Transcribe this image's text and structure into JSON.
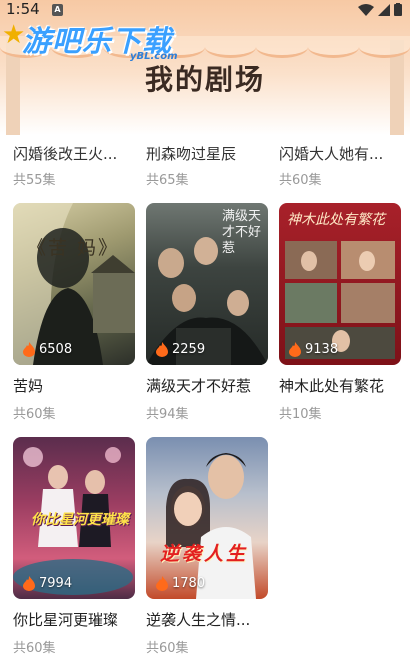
{
  "status": {
    "time": "1:54",
    "notif": "A"
  },
  "watermark": {
    "main": "游吧乐下载",
    "sub": "yBL.com"
  },
  "page_title": "我的剧场",
  "partial_row": [
    {
      "title": "闪婚後改王火...",
      "episodes": "共55集"
    },
    {
      "title": "刑森吻过星辰",
      "episodes": "共65集"
    },
    {
      "title": "闪婚大人她有...",
      "episodes": "共60集"
    }
  ],
  "dramas": [
    {
      "title": "苦妈",
      "episodes": "共60集",
      "views": "6508",
      "poster_text": "《苦 妈》"
    },
    {
      "title": "满级天才不好惹",
      "episodes": "共94集",
      "views": "2259",
      "poster_text": "满级天才不好惹"
    },
    {
      "title": "神木此处有繁花",
      "episodes": "共10集",
      "views": "9138",
      "poster_text": "神木此处有繁花"
    },
    {
      "title": "你比星河更璀璨",
      "episodes": "共60集",
      "views": "7994",
      "poster_text": "你比星河更璀璨"
    },
    {
      "title": "逆袭人生之情...",
      "episodes": "共60集",
      "views": "1780",
      "poster_text": "逆袭人生"
    }
  ],
  "colors": {
    "accent_flame": "#ff6a1a",
    "title_text": "#222222",
    "muted_text": "#999999"
  },
  "icons": {
    "flame": "flame-icon",
    "wifi": "wifi-icon",
    "signal": "signal-icon",
    "battery": "battery-icon"
  }
}
